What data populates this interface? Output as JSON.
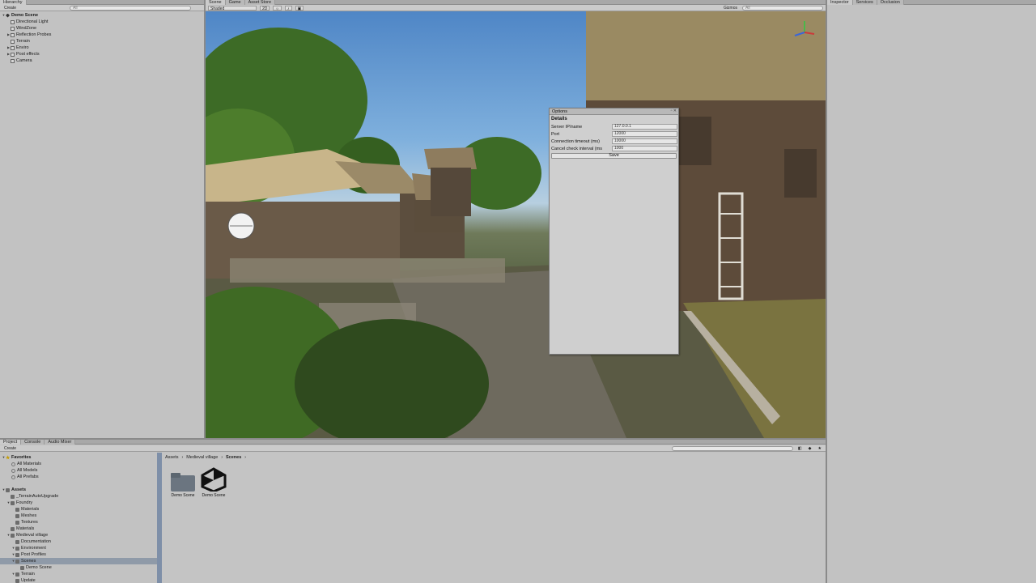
{
  "colors": {
    "panel_bg": "#c2c2c2",
    "tab_bg": "#a8a8a8",
    "selection": "#8f9aa8",
    "sky": "#4f86c6"
  },
  "hierarchy": {
    "tab_label": "Hierarchy",
    "create_label": "Create",
    "search_placeholder": "All",
    "root": "Demo Scene",
    "items": [
      {
        "label": "Directional Light",
        "expandable": false
      },
      {
        "label": "WindZone",
        "expandable": false
      },
      {
        "label": "Reflection Probes",
        "expandable": true
      },
      {
        "label": "Terrain",
        "expandable": false
      },
      {
        "label": "Enviro",
        "expandable": true
      },
      {
        "label": "Post effects",
        "expandable": true
      },
      {
        "label": "Camera",
        "expandable": false
      }
    ]
  },
  "scene": {
    "tabs": [
      "Scene",
      "Game",
      "Asset Store"
    ],
    "active_tab": "Scene",
    "shading_mode": "Shaded",
    "toolbar_2d": "2D",
    "gizmos_label": "Gizmos",
    "search_placeholder": "All"
  },
  "right_panel": {
    "tabs": [
      "Inspector",
      "Services",
      "Occlusion"
    ]
  },
  "options_dialog": {
    "title": "Options",
    "section": "Details",
    "fields": [
      {
        "label": "Server IP/name",
        "value": "127.0.0.1"
      },
      {
        "label": "Port",
        "value": "12000"
      },
      {
        "label": "Connection timeout (ms)",
        "value": "10000"
      },
      {
        "label": "Cancel check interval (ms",
        "value": "1000"
      }
    ],
    "save_label": "Save"
  },
  "project": {
    "tabs": [
      "Project",
      "Console",
      "Audio Mixer"
    ],
    "create_label": "Create",
    "breadcrumb": [
      "Assets",
      "Medieval village",
      "Scenes"
    ],
    "favorites_label": "Favorites",
    "favorites": [
      "All Materials",
      "All Models",
      "All Prefabs"
    ],
    "assets_label": "Assets",
    "tree": [
      {
        "label": "_TerrainAutoUpgrade",
        "depth": 1
      },
      {
        "label": "Foundry",
        "depth": 1,
        "expandable": true
      },
      {
        "label": "Materials",
        "depth": 2
      },
      {
        "label": "Meshes",
        "depth": 2
      },
      {
        "label": "Textures",
        "depth": 2
      },
      {
        "label": "Materials",
        "depth": 1
      },
      {
        "label": "Medieval village",
        "depth": 1,
        "expandable": true
      },
      {
        "label": "Documentation",
        "depth": 2
      },
      {
        "label": "Environment",
        "depth": 2,
        "expandable": true
      },
      {
        "label": "Post Profiles",
        "depth": 2,
        "expandable": true
      },
      {
        "label": "Scenes",
        "depth": 2,
        "expandable": true,
        "selected": true
      },
      {
        "label": "Demo Scene",
        "depth": 3
      },
      {
        "label": "Terrain",
        "depth": 2,
        "expandable": true
      },
      {
        "label": "Update",
        "depth": 2
      }
    ],
    "assets": [
      {
        "label": "Demo Scene",
        "kind": "folder"
      },
      {
        "label": "Demo Scene",
        "kind": "unity-scene"
      }
    ]
  }
}
